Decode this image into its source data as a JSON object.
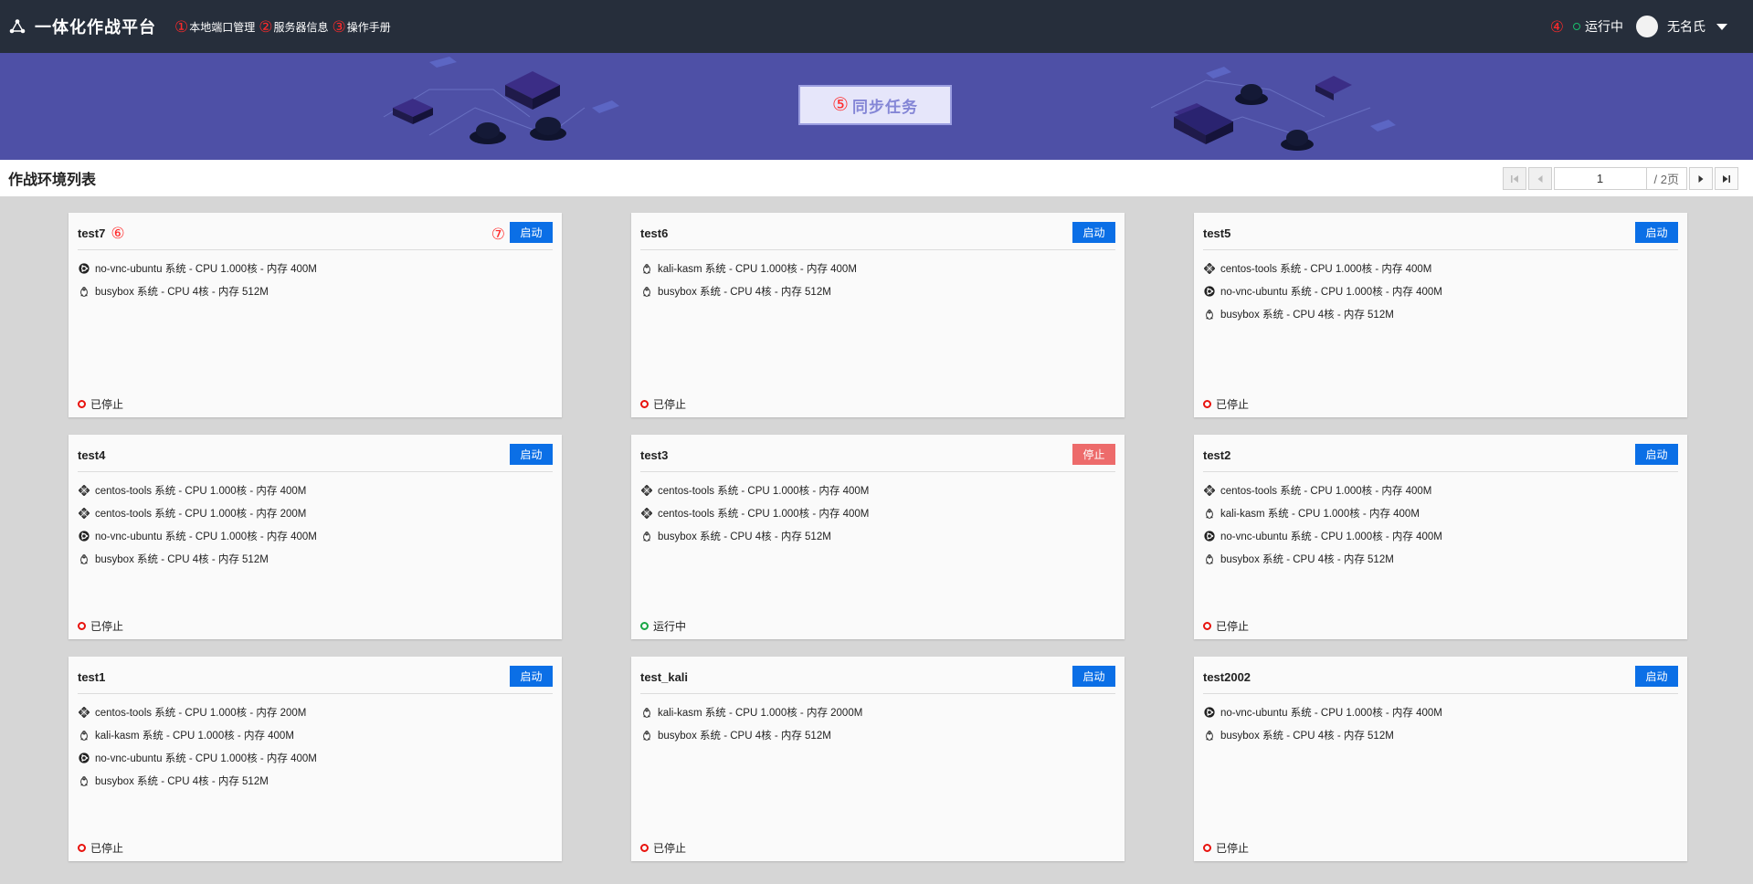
{
  "app": {
    "title": "一体化作战平台"
  },
  "nav": [
    {
      "marker": "①",
      "label": "本地端口管理"
    },
    {
      "marker": "②",
      "label": "服务器信息"
    },
    {
      "marker": "③",
      "label": "操作手册"
    }
  ],
  "header_right": {
    "marker": "④",
    "status": "运行中",
    "username": "无名氏"
  },
  "banner": {
    "marker": "⑤",
    "sync_label": "同步任务"
  },
  "list": {
    "title": "作战环境列表"
  },
  "pagination": {
    "current": "1",
    "total_label": "/ 2页"
  },
  "annotations": {
    "card_name_marker": "⑥",
    "card_button_marker": "⑦"
  },
  "colors": {
    "topbar": "#262e3b",
    "banner": "#4e50a6",
    "start": "#0b6fe6",
    "stop": "#ed6b6b",
    "stopped": "#e8130e",
    "running": "#19a645"
  },
  "cards": [
    {
      "name": "test7",
      "button": "启动",
      "status": "已停止",
      "items": [
        {
          "icon": "ubuntu-icon",
          "text": "no-vnc-ubuntu 系统 - CPU 1.000核 - 内存 400M"
        },
        {
          "icon": "linux-icon",
          "text": "busybox 系统 - CPU 4核 - 内存 512M"
        }
      ]
    },
    {
      "name": "test6",
      "button": "启动",
      "status": "已停止",
      "items": [
        {
          "icon": "linux-icon",
          "text": "kali-kasm 系统 - CPU 1.000核 - 内存 400M"
        },
        {
          "icon": "linux-icon",
          "text": "busybox 系统 - CPU 4核 - 内存 512M"
        }
      ]
    },
    {
      "name": "test5",
      "button": "启动",
      "status": "已停止",
      "items": [
        {
          "icon": "centos-icon",
          "text": "centos-tools 系统 - CPU 1.000核 - 内存 400M"
        },
        {
          "icon": "ubuntu-icon",
          "text": "no-vnc-ubuntu 系统 - CPU 1.000核 - 内存 400M"
        },
        {
          "icon": "linux-icon",
          "text": "busybox 系统 - CPU 4核 - 内存 512M"
        }
      ]
    },
    {
      "name": "test4",
      "button": "启动",
      "status": "已停止",
      "items": [
        {
          "icon": "centos-icon",
          "text": "centos-tools 系统 - CPU 1.000核 - 内存 400M"
        },
        {
          "icon": "centos-icon",
          "text": "centos-tools 系统 - CPU 1.000核 - 内存 200M"
        },
        {
          "icon": "ubuntu-icon",
          "text": "no-vnc-ubuntu 系统 - CPU 1.000核 - 内存 400M"
        },
        {
          "icon": "linux-icon",
          "text": "busybox 系统 - CPU 4核 - 内存 512M"
        }
      ]
    },
    {
      "name": "test3",
      "button": "停止",
      "status": "运行中",
      "items": [
        {
          "icon": "centos-icon",
          "text": "centos-tools 系统 - CPU 1.000核 - 内存 400M"
        },
        {
          "icon": "centos-icon",
          "text": "centos-tools 系统 - CPU 1.000核 - 内存 400M"
        },
        {
          "icon": "linux-icon",
          "text": "busybox 系统 - CPU 4核 - 内存 512M"
        }
      ]
    },
    {
      "name": "test2",
      "button": "启动",
      "status": "已停止",
      "items": [
        {
          "icon": "centos-icon",
          "text": "centos-tools 系统 - CPU 1.000核 - 内存 400M"
        },
        {
          "icon": "linux-icon",
          "text": "kali-kasm 系统 - CPU 1.000核 - 内存 400M"
        },
        {
          "icon": "ubuntu-icon",
          "text": "no-vnc-ubuntu 系统 - CPU 1.000核 - 内存 400M"
        },
        {
          "icon": "linux-icon",
          "text": "busybox 系统 - CPU 4核 - 内存 512M"
        }
      ]
    },
    {
      "name": "test1",
      "button": "启动",
      "status": "已停止",
      "items": [
        {
          "icon": "centos-icon",
          "text": "centos-tools 系统 - CPU 1.000核 - 内存 200M"
        },
        {
          "icon": "linux-icon",
          "text": "kali-kasm 系统 - CPU 1.000核 - 内存 400M"
        },
        {
          "icon": "ubuntu-icon",
          "text": "no-vnc-ubuntu 系统 - CPU 1.000核 - 内存 400M"
        },
        {
          "icon": "linux-icon",
          "text": "busybox 系统 - CPU 4核 - 内存 512M"
        }
      ]
    },
    {
      "name": "test_kali",
      "button": "启动",
      "status": "已停止",
      "items": [
        {
          "icon": "linux-icon",
          "text": "kali-kasm 系统 - CPU 1.000核 - 内存 2000M"
        },
        {
          "icon": "linux-icon",
          "text": "busybox 系统 - CPU 4核 - 内存 512M"
        }
      ]
    },
    {
      "name": "test2002",
      "button": "启动",
      "status": "已停止",
      "items": [
        {
          "icon": "ubuntu-icon",
          "text": "no-vnc-ubuntu 系统 - CPU 1.000核 - 内存 400M"
        },
        {
          "icon": "linux-icon",
          "text": "busybox 系统 - CPU 4核 - 内存 512M"
        }
      ]
    }
  ]
}
